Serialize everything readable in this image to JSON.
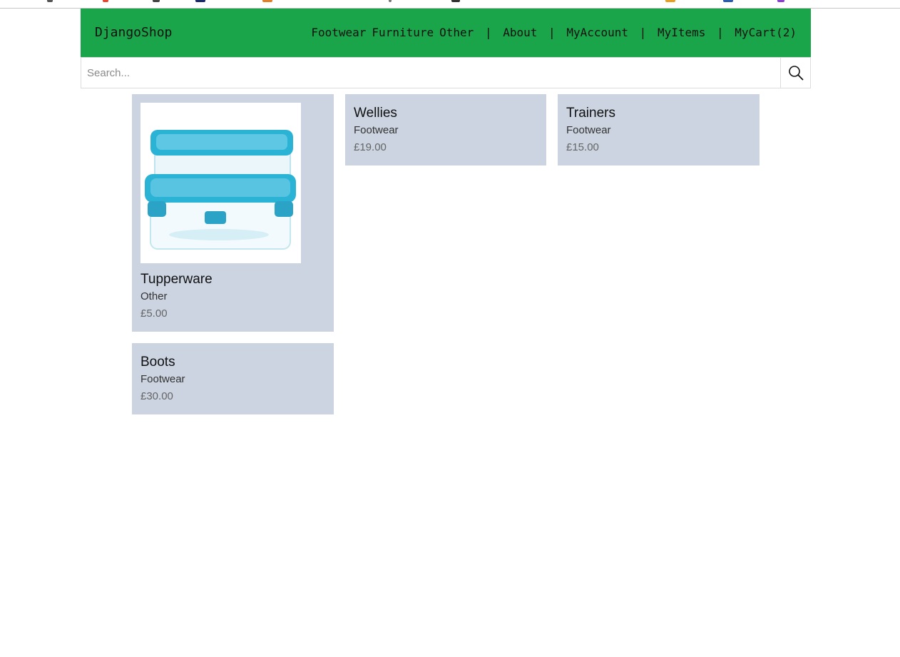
{
  "theme": {
    "nav_bg": "#1aa54a",
    "card_bg": "#cbd4e0",
    "lid_color": "#2bb3d6"
  },
  "navbar": {
    "brand": "DjangoShop",
    "categories": [
      "Footwear",
      "Furniture",
      "Other"
    ],
    "separator": "|",
    "links": [
      "About",
      "MyAccount",
      "MyItems",
      "MyCart(2)"
    ]
  },
  "search": {
    "placeholder": "Search...",
    "value": "",
    "icon": "search-icon"
  },
  "products": [
    {
      "title": "Tupperware",
      "category": "Other",
      "price": "£5.00",
      "image": "tupperware-image"
    },
    {
      "title": "Wellies",
      "category": "Footwear",
      "price": "£19.00"
    },
    {
      "title": "Trainers",
      "category": "Footwear",
      "price": "£15.00"
    },
    {
      "title": "Boots",
      "category": "Footwear",
      "price": "£30.00"
    }
  ]
}
